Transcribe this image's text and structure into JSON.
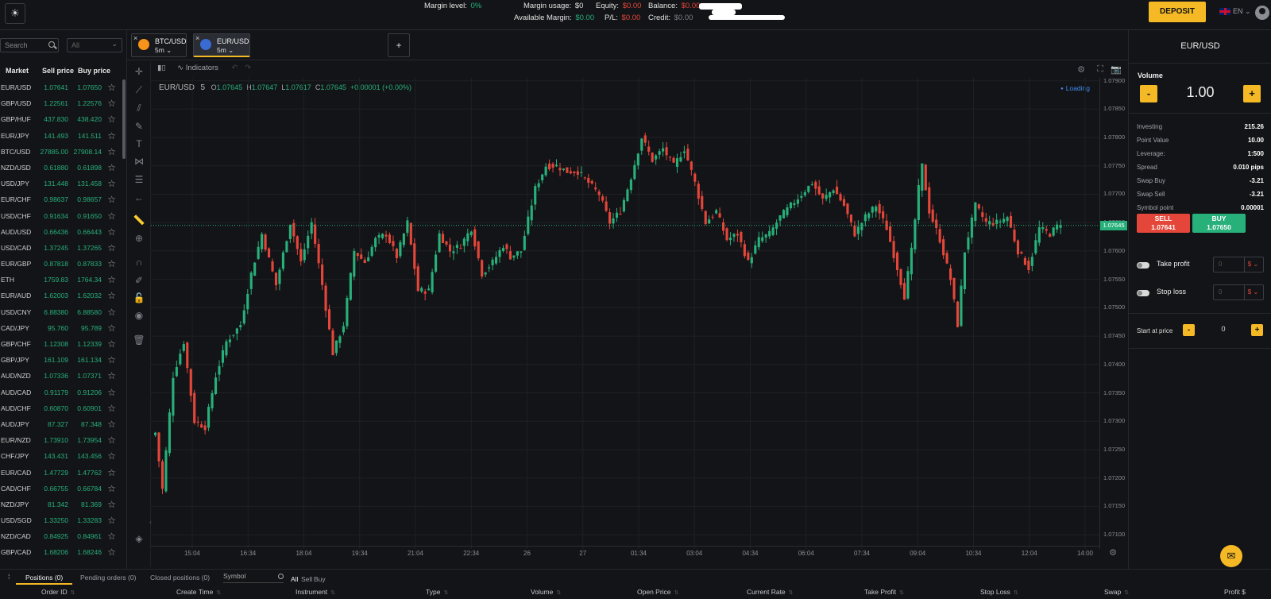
{
  "topbar": {
    "margin_level_label": "Margin level:",
    "margin_level_value": "0%",
    "margin_usage_label": "Margin usage:",
    "margin_usage_value": "$0",
    "available_margin_label": "Available Margin:",
    "available_margin_value": "$0.00",
    "equity_label": "Equity:",
    "equity_value": "$0.00",
    "pl_label": "P/L:",
    "pl_value": "$0.00",
    "balance_label": "Balance:",
    "balance_value": "$0.00",
    "credit_label": "Credit:",
    "credit_value": "$0.00",
    "deposit_label": "DEPOSIT",
    "language": "EN"
  },
  "market": {
    "search_placeholder": "Search",
    "filter_value": "All",
    "headers": {
      "market": "Market",
      "sell": "Sell price",
      "buy": "Buy price"
    },
    "rows": [
      {
        "sym": "EUR/USD",
        "sell": "1.07641",
        "buy": "1.07650"
      },
      {
        "sym": "GBP/USD",
        "sell": "1.22561",
        "buy": "1.22576"
      },
      {
        "sym": "GBP/HUF",
        "sell": "437.830",
        "buy": "438.420"
      },
      {
        "sym": "EUR/JPY",
        "sell": "141.493",
        "buy": "141.511"
      },
      {
        "sym": "BTC/USD",
        "sell": "27885.00",
        "buy": "27908.14"
      },
      {
        "sym": "NZD/USD",
        "sell": "0.61880",
        "buy": "0.61898"
      },
      {
        "sym": "USD/JPY",
        "sell": "131.448",
        "buy": "131.458"
      },
      {
        "sym": "EUR/CHF",
        "sell": "0.98637",
        "buy": "0.98657"
      },
      {
        "sym": "USD/CHF",
        "sell": "0.91634",
        "buy": "0.91650"
      },
      {
        "sym": "AUD/USD",
        "sell": "0.66436",
        "buy": "0.66443"
      },
      {
        "sym": "USD/CAD",
        "sell": "1.37245",
        "buy": "1.37265"
      },
      {
        "sym": "EUR/GBP",
        "sell": "0.87818",
        "buy": "0.87833"
      },
      {
        "sym": "ETH",
        "sell": "1759.83",
        "buy": "1764.34"
      },
      {
        "sym": "EUR/AUD",
        "sell": "1.62003",
        "buy": "1.62032"
      },
      {
        "sym": "USD/CNY",
        "sell": "6.88380",
        "buy": "6.88580"
      },
      {
        "sym": "CAD/JPY",
        "sell": "95.760",
        "buy": "95.789"
      },
      {
        "sym": "GBP/CHF",
        "sell": "1.12308",
        "buy": "1.12339"
      },
      {
        "sym": "GBP/JPY",
        "sell": "161.109",
        "buy": "161.134"
      },
      {
        "sym": "AUD/NZD",
        "sell": "1.07336",
        "buy": "1.07371"
      },
      {
        "sym": "AUD/CAD",
        "sell": "0.91179",
        "buy": "0.91206"
      },
      {
        "sym": "AUD/CHF",
        "sell": "0.60870",
        "buy": "0.60901"
      },
      {
        "sym": "AUD/JPY",
        "sell": "87.327",
        "buy": "87.348"
      },
      {
        "sym": "EUR/NZD",
        "sell": "1.73910",
        "buy": "1.73954"
      },
      {
        "sym": "CHF/JPY",
        "sell": "143.431",
        "buy": "143.456"
      },
      {
        "sym": "EUR/CAD",
        "sell": "1.47729",
        "buy": "1.47762"
      },
      {
        "sym": "CAD/CHF",
        "sell": "0.66755",
        "buy": "0.66784"
      },
      {
        "sym": "NZD/JPY",
        "sell": "81.342",
        "buy": "81.369"
      },
      {
        "sym": "USD/SGD",
        "sell": "1.33250",
        "buy": "1.33283"
      },
      {
        "sym": "NZD/CAD",
        "sell": "0.84925",
        "buy": "0.84961"
      },
      {
        "sym": "GBP/CAD",
        "sell": "1.68206",
        "buy": "1.68246"
      }
    ]
  },
  "tabs": [
    {
      "name": "BTC/USD",
      "tf": "5m"
    },
    {
      "name": "EUR/USD",
      "tf": "5m"
    }
  ],
  "add_tab_label": "+",
  "chart_header": {
    "indicators_label": "Indicators",
    "symbol": "EUR/USD",
    "interval": "5",
    "o_label": "O",
    "o": "1.07645",
    "h_label": "H",
    "h": "1.07647",
    "l_label": "L",
    "l": "1.07617",
    "c_label": "C",
    "c": "1.07645",
    "change": "+0.00001 (+0.00%)",
    "loading": "Loading"
  },
  "chart_data": {
    "type": "candlestick",
    "symbol": "EUR/USD",
    "interval": "5",
    "ylim": [
      1.07075,
      1.07905
    ],
    "y_ticks": [
      "1.07900",
      "1.07850",
      "1.07800",
      "1.07750",
      "1.07700",
      "1.07650",
      "1.07600",
      "1.07550",
      "1.07500",
      "1.07450",
      "1.07400",
      "1.07350",
      "1.07300",
      "1.07250",
      "1.07200",
      "1.07150",
      "1.07100"
    ],
    "x_ticks": [
      "15:04",
      "16:34",
      "18:04",
      "19:34",
      "21:04",
      "22:34",
      "26",
      "27",
      "01:34",
      "03:04",
      "04:34",
      "06:04",
      "07:34",
      "09:04",
      "10:34",
      "12:04",
      "14:00"
    ],
    "current_price": "1.07645",
    "anchors": [
      [
        0,
        1.0728
      ],
      [
        2,
        1.0718
      ],
      [
        5,
        1.0738
      ],
      [
        8,
        1.0744
      ],
      [
        11,
        1.073
      ],
      [
        14,
        1.0729
      ],
      [
        17,
        1.0738
      ],
      [
        20,
        1.0744
      ],
      [
        24,
        1.0747
      ],
      [
        27,
        1.0756
      ],
      [
        30,
        1.0763
      ],
      [
        34,
        1.0754
      ],
      [
        38,
        1.0765
      ],
      [
        41,
        1.0758
      ],
      [
        44,
        1.0765
      ],
      [
        47,
        1.0754
      ],
      [
        50,
        1.0742
      ],
      [
        53,
        1.0747
      ],
      [
        56,
        1.076
      ],
      [
        59,
        1.0758
      ],
      [
        62,
        1.0762
      ],
      [
        65,
        1.0763
      ],
      [
        68,
        1.0759
      ],
      [
        71,
        1.0765
      ],
      [
        74,
        1.0753
      ],
      [
        77,
        1.0753
      ],
      [
        80,
        1.0763
      ],
      [
        83,
        1.076
      ],
      [
        86,
        1.0761
      ],
      [
        89,
        1.0764
      ],
      [
        92,
        1.0756
      ],
      [
        95,
        1.0758
      ],
      [
        98,
        1.0761
      ],
      [
        100,
        1.0759
      ],
      [
        103,
        1.076
      ],
      [
        107,
        1.0771
      ],
      [
        110,
        1.0775
      ],
      [
        113,
        1.0775
      ],
      [
        116,
        1.0774
      ],
      [
        119,
        1.0774
      ],
      [
        122,
        1.0772
      ],
      [
        125,
        1.077
      ],
      [
        128,
        1.0765
      ],
      [
        131,
        1.0767
      ],
      [
        134,
        1.0773
      ],
      [
        137,
        1.078
      ],
      [
        140,
        1.0776
      ],
      [
        143,
        1.0778
      ],
      [
        146,
        1.0775
      ],
      [
        149,
        1.0778
      ],
      [
        152,
        1.0772
      ],
      [
        155,
        1.0765
      ],
      [
        158,
        1.0767
      ],
      [
        161,
        1.0762
      ],
      [
        164,
        1.0763
      ],
      [
        167,
        1.0758
      ],
      [
        170,
        1.0762
      ],
      [
        173,
        1.0763
      ],
      [
        176,
        1.0766
      ],
      [
        179,
        1.0768
      ],
      [
        182,
        1.077
      ],
      [
        185,
        1.0772
      ],
      [
        188,
        1.0769
      ],
      [
        191,
        1.0771
      ],
      [
        194,
        1.0768
      ],
      [
        197,
        1.0763
      ],
      [
        200,
        1.0766
      ],
      [
        203,
        1.0768
      ],
      [
        206,
        1.0764
      ],
      [
        209,
        1.0757
      ],
      [
        211,
        1.0752
      ],
      [
        213,
        1.076
      ],
      [
        215,
        1.0771
      ],
      [
        216,
        1.0775
      ],
      [
        218,
        1.0767
      ],
      [
        221,
        1.0762
      ],
      [
        224,
        1.0755
      ],
      [
        226,
        1.0747
      ],
      [
        228,
        1.076
      ],
      [
        231,
        1.0768
      ],
      [
        234,
        1.0765
      ],
      [
        237,
        1.0765
      ],
      [
        240,
        1.0766
      ],
      [
        243,
        1.076
      ],
      [
        246,
        1.0757
      ],
      [
        249,
        1.0764
      ],
      [
        252,
        1.0763
      ],
      [
        255,
        1.0765
      ]
    ]
  },
  "right_panel": {
    "title": "EUR/USD",
    "volume_label": "Volume",
    "volume_value": "1.00",
    "minus": "-",
    "plus": "+",
    "info": [
      {
        "k": "Investing",
        "v": "215.26"
      },
      {
        "k": "Point Value",
        "v": "10.00"
      },
      {
        "k": "Leverage:",
        "v": "1:500"
      },
      {
        "k": "Spread",
        "v": "0.010 pips"
      },
      {
        "k": "Swap Buy",
        "v": "-3.21"
      },
      {
        "k": "Swap Sell",
        "v": "-3.21"
      },
      {
        "k": "Symbol point",
        "v": "0.00001"
      }
    ],
    "sell_label": "SELL",
    "sell_price": "1.07641",
    "buy_label": "BUY",
    "buy_price": "1.07650",
    "take_profit_label": "Take profit",
    "stop_loss_label": "Stop loss",
    "tp_placeholder": "0",
    "sl_placeholder": "0",
    "currency": "$",
    "start_at_price_label": "Start at price",
    "start_at_price_value": "0"
  },
  "bottom": {
    "positions_tab": "Positions (0)",
    "pending_tab": "Pending orders (0)",
    "closed_tab": "Closed positions (0)",
    "symbol_placeholder": "Symbol",
    "filter_all": "All",
    "filter_sell": "Sell",
    "filter_buy": "Buy",
    "columns": [
      "Order ID",
      "Create Time",
      "Instrument",
      "Type",
      "Volume",
      "Open Price",
      "Current Rate",
      "Take Profit",
      "Stop Loss",
      "Swap",
      "Profit $"
    ]
  },
  "colors": {
    "up": "#27b07a",
    "down": "#e5463a",
    "accent": "#f4b925",
    "loading": "#3f8df2"
  }
}
